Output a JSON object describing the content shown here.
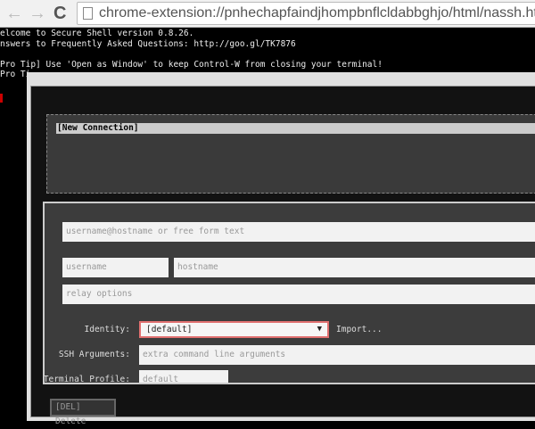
{
  "browser": {
    "url": "chrome-extension://pnhechapfaindjhompbnflcldabbghjo/html/nassh.html",
    "back": "←",
    "forward": "→",
    "reload": "C"
  },
  "terminal": {
    "lines": [
      "elcome to Secure Shell version 0.8.26.",
      "nswers to Frequently Asked Questions: http://goo.gl/TK7876",
      "",
      "Pro Tip] Use 'Open as Window' to keep Control-W from closing your terminal!",
      "Pro Ti"
    ]
  },
  "dialog": {
    "connections": [
      "[New Connection]"
    ],
    "form": {
      "destination_placeholder": "username@hostname or free form text",
      "username_placeholder": "username",
      "hostname_placeholder": "hostname",
      "relay_placeholder": "relay options",
      "identity_label": "Identity:",
      "identity_value": "[default]",
      "import_label": "Import...",
      "ssh_args_label": "SSH Arguments:",
      "ssh_args_placeholder": "extra command line arguments",
      "terminal_profile_label": "Terminal Profile:",
      "terminal_profile_placeholder": "default"
    },
    "delete_button": "[DEL] Delete"
  }
}
